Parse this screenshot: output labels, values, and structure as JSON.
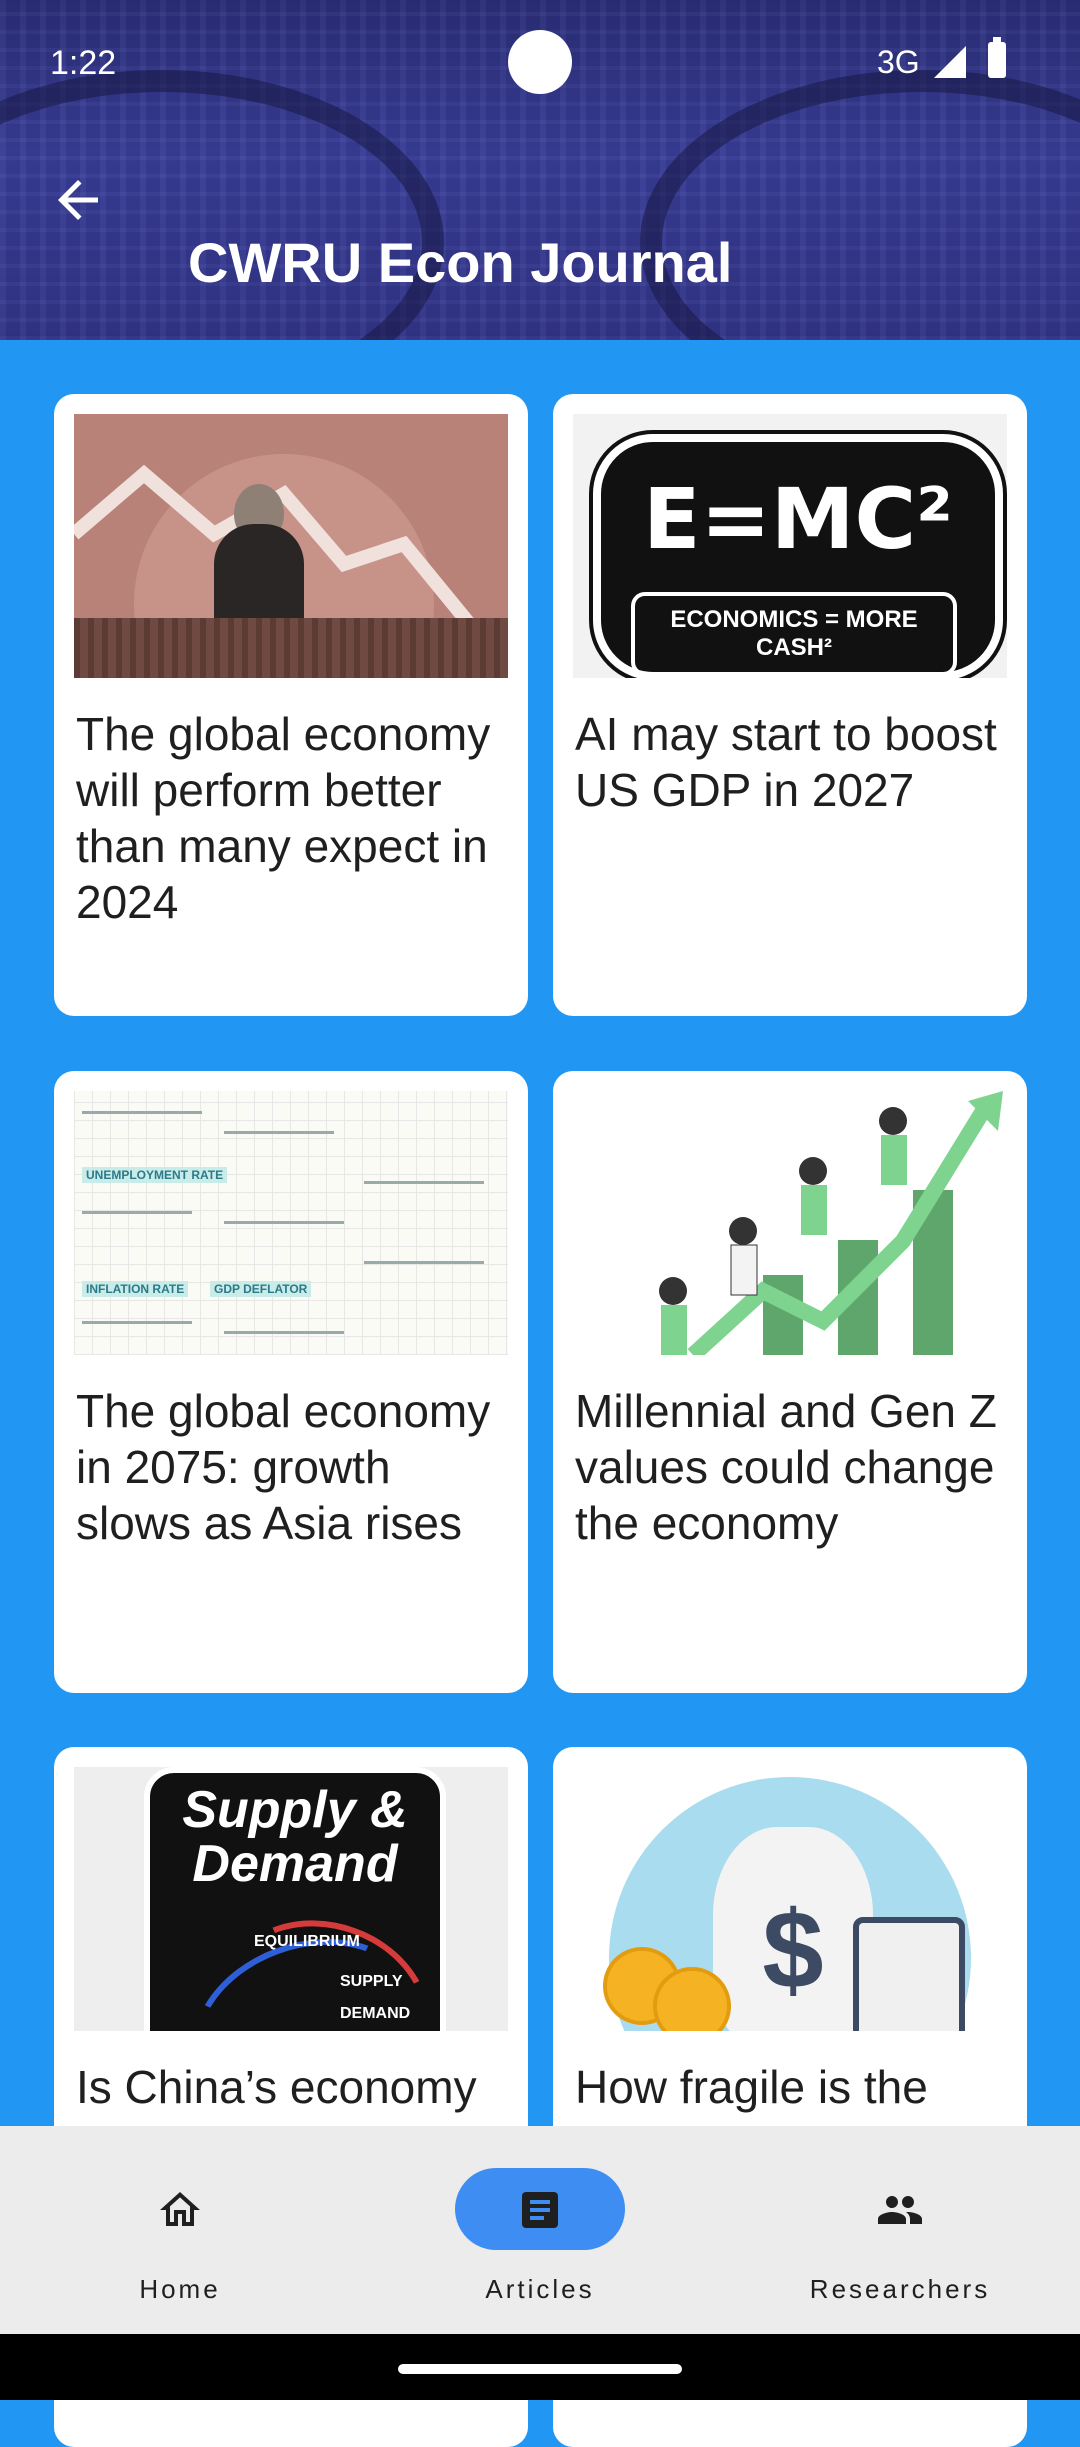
{
  "status_bar": {
    "time": "1:22",
    "network": "3G"
  },
  "app_bar": {
    "title": "CWRU Econ Journal"
  },
  "articles": [
    {
      "title": "The global economy will perform better than many expect in 2024",
      "thumbnail": "man-falling-chart-image"
    },
    {
      "title": "AI may start to boost US GDP in 2027",
      "thumbnail": "emc2-sticker-image",
      "thumb_text_main": "E=MC²",
      "thumb_text_sub": "ECONOMICS = MORE CASH²"
    },
    {
      "title": "The global economy in 2075: growth slows as Asia rises",
      "thumbnail": "econ-notes-image",
      "thumb_tags": [
        "UNEMPLOYMENT RATE",
        "INFLATION RATE",
        "GDP DEFLATOR"
      ]
    },
    {
      "title": "Millennial and Gen Z values could change the economy",
      "thumbnail": "team-climbing-chart-image"
    },
    {
      "title": "Is China’s economy",
      "thumbnail": "supply-demand-sticker-image",
      "thumb_text_main": "Supply & Demand",
      "thumb_labels": [
        "EQUILIBRIUM",
        "SUPPLY",
        "DEMAND"
      ]
    },
    {
      "title": "How fragile is the",
      "thumbnail": "money-bag-calculator-image"
    }
  ],
  "bottom_nav": {
    "items": [
      {
        "label": "Home",
        "icon": "home-icon",
        "selected": false
      },
      {
        "label": "Articles",
        "icon": "article-icon",
        "selected": true
      },
      {
        "label": "Researchers",
        "icon": "people-icon",
        "selected": false
      }
    ]
  },
  "colors": {
    "background": "#2196F3",
    "nav_background": "#ECECEC",
    "selected_pill": "#3D8DF2",
    "card": "#FFFFFF"
  }
}
